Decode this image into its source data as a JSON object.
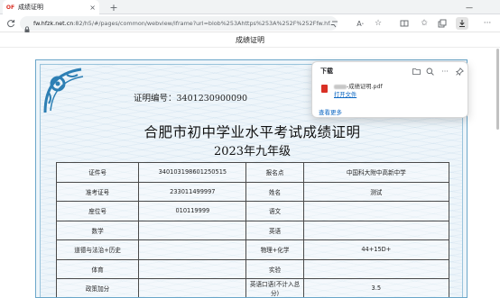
{
  "browser": {
    "tab": {
      "favicon_text": "OF",
      "title": "成绩证明",
      "close_glyph": "×"
    },
    "new_tab_glyph": "+",
    "minimize_glyph": "—",
    "address_bar": {
      "host": "fw.hfzk.net.cn",
      "path": ":82/h5/#/pages/common/webview/iframe?url=blob%253Ahttps%253A%252F%252Ffw.hf..."
    },
    "icons": [
      "refresh-icon",
      "lock-icon",
      "read-aloud-icon",
      "font-icon",
      "favorite-star-icon",
      "split-screen-icon",
      "favorites-icon",
      "collections-icon",
      "downloads-icon",
      "more-icon"
    ]
  },
  "page": {
    "title": "成绩证明"
  },
  "certificate": {
    "number_label": "证明编号：",
    "number_value": "3401230900090",
    "title": "合肥市初中学业水平考试成绩证明",
    "year": "2023年九年级",
    "rows": [
      [
        "证件号",
        "34010319860125051​5",
        "报名点",
        "中国科大附中高新中学"
      ],
      [
        "准考证号",
        "233011499997",
        "姓名",
        "测试"
      ],
      [
        "座位号",
        "010119999",
        "语文",
        ""
      ],
      [
        "数学",
        "",
        "英语",
        ""
      ],
      [
        "道德与法治+历史",
        "",
        "物理+化学",
        "44+15D+"
      ],
      [
        "体育",
        "",
        "实验",
        ""
      ],
      [
        "政策加分",
        "",
        "英语口语(不计入总分)",
        "3.5"
      ]
    ]
  },
  "downloads": {
    "heading": "下载",
    "file_name": "-成绩证明.pdf",
    "open_label": "打开文件",
    "see_more": "查看更多"
  },
  "colors": {
    "accent": "#0a66c2",
    "cert_border": "#6aa6c9",
    "cert_background": "#eef5fa",
    "ornament": "#2d7fb4",
    "pdf_red": "#d93025"
  }
}
